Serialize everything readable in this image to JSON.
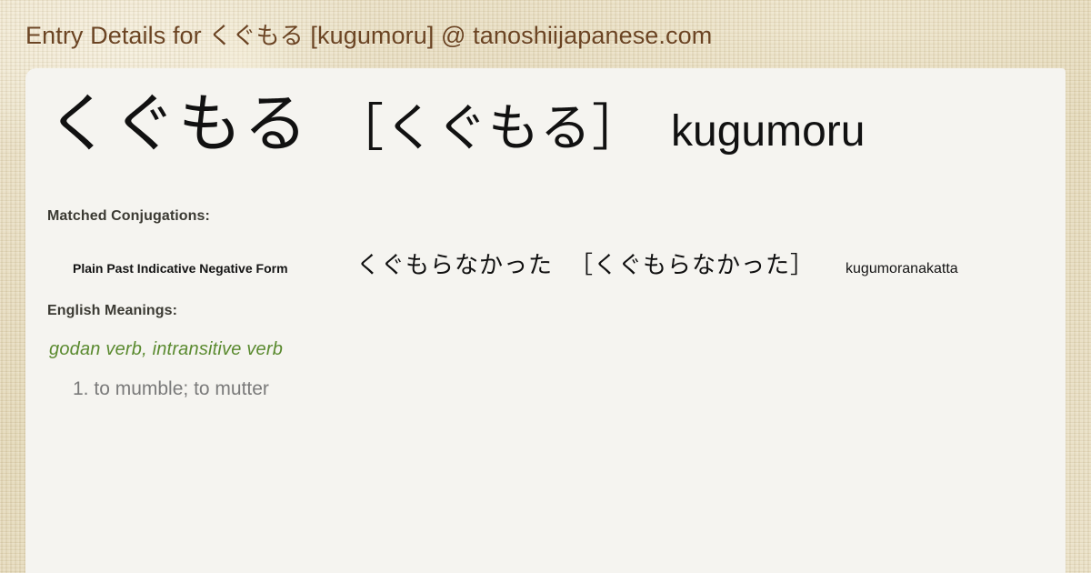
{
  "header": {
    "prefix": "Entry Details for ",
    "jp_word": "くぐもる",
    "suffix": " [kugumoru] @ tanoshiijapanese.com",
    "full_title": "Entry Details for くぐもる [kugumoru] @ tanoshiijapanese.com",
    "text_color": "#6b4423"
  },
  "entry": {
    "headword": "くぐもる",
    "reading": "［くぐもる］",
    "romaji": "kugumoru"
  },
  "conjugations": {
    "label": "Matched Conjugations:",
    "rows": [
      {
        "form_name": "Plain Past Indicative Negative Form",
        "japanese": "くぐもらなかった",
        "reading": "［くぐもらなかった］",
        "romaji": "kugumoranakatta"
      }
    ]
  },
  "meanings": {
    "label": "English Meanings:",
    "pos_tags": "godan verb, intransitive verb",
    "pos_color": "#5a8a2f",
    "definitions": [
      {
        "number": "1.",
        "text": "to mumble; to mutter"
      }
    ]
  },
  "theme": {
    "paper_background": "#e3d7b8",
    "card_background": "#f5f4f0",
    "definition_color": "#7a7a7a"
  }
}
